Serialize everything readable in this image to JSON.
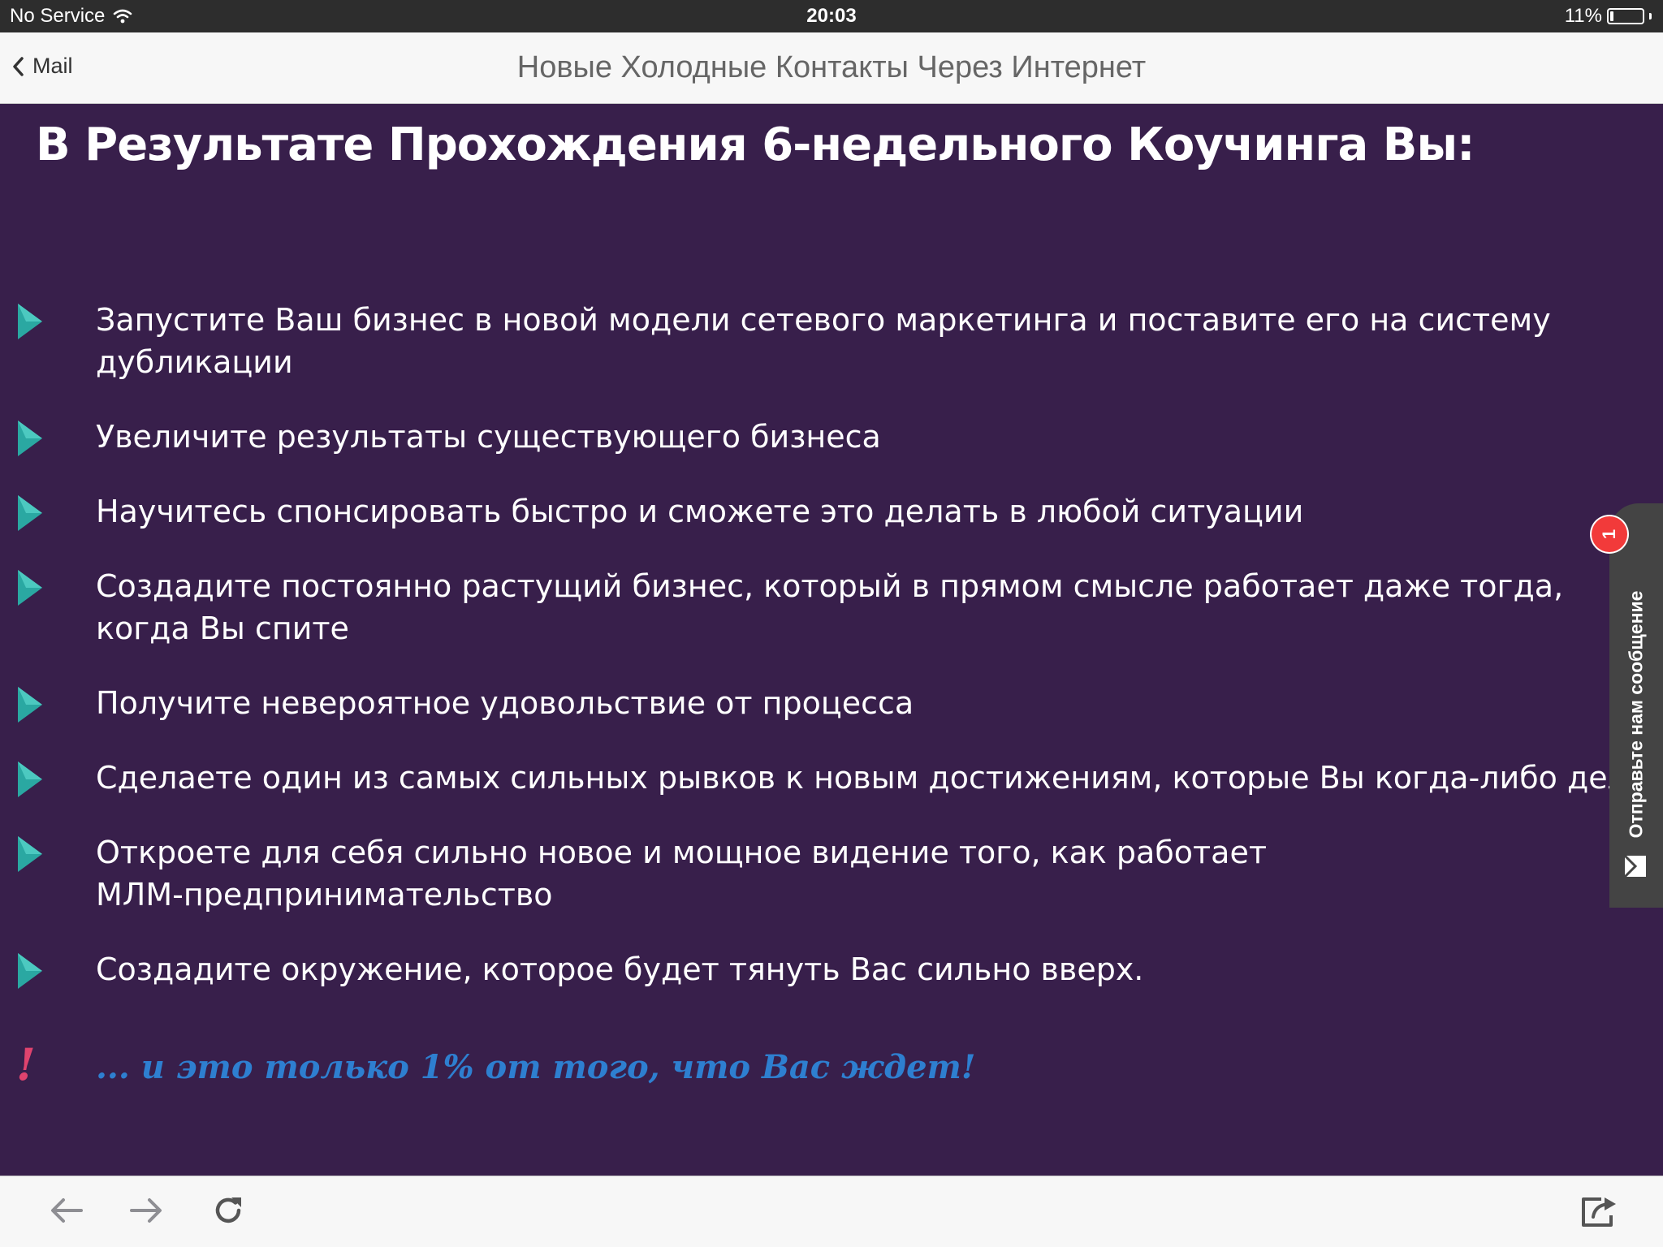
{
  "status_bar": {
    "carrier": "No Service",
    "time": "20:03",
    "battery": "11%",
    "battery_level": 0.11
  },
  "nav": {
    "back_label": "Mail",
    "title": "Новые Холодные Контакты Через Интернет"
  },
  "content": {
    "headline": "В Результате Прохождения 6-недельного Коучинга Вы:",
    "benefits": [
      {
        "text": "Запустите Ваш бизнес в новой модели сетевого маркетинга и поставите его на систему дубликации"
      },
      {
        "text": "Увеличите результаты существующего бизнеса"
      },
      {
        "text": "Научитесь спонсировать быстро и сможете это делать в любой ситуации"
      },
      {
        "text": "Создадите постоянно растущий бизнес, который в прямом смысле работает даже тогда, когда Вы спите"
      },
      {
        "text": "Получите невероятное удовольствие от процесса"
      },
      {
        "text": "Сделаете один из самых сильных рывков к новым достижениям, которые Вы когда-либо делал"
      },
      {
        "text": "Откроете для себя сильно новое и мощное видение того, как работает МЛМ-предпринимательство"
      },
      {
        "text": "Создадите окружение, которое будет тянуть Вас сильно вверх."
      }
    ],
    "closing_mark": "!",
    "closing": "... и это только 1% от того, что Вас ждет!"
  },
  "message_tab": {
    "label": "Отправьте нам сообщение",
    "badge_count": "1"
  },
  "toolbar": {
    "icons": [
      "back-arrow-icon",
      "forward-arrow-icon",
      "reload-icon",
      "share-icon"
    ]
  },
  "colors": {
    "background": "#381f4b",
    "bullet": "#2aa8a2",
    "closing_text": "#2e7fd0",
    "exclamation": "#e0436e",
    "badge": "#f23a3a"
  }
}
